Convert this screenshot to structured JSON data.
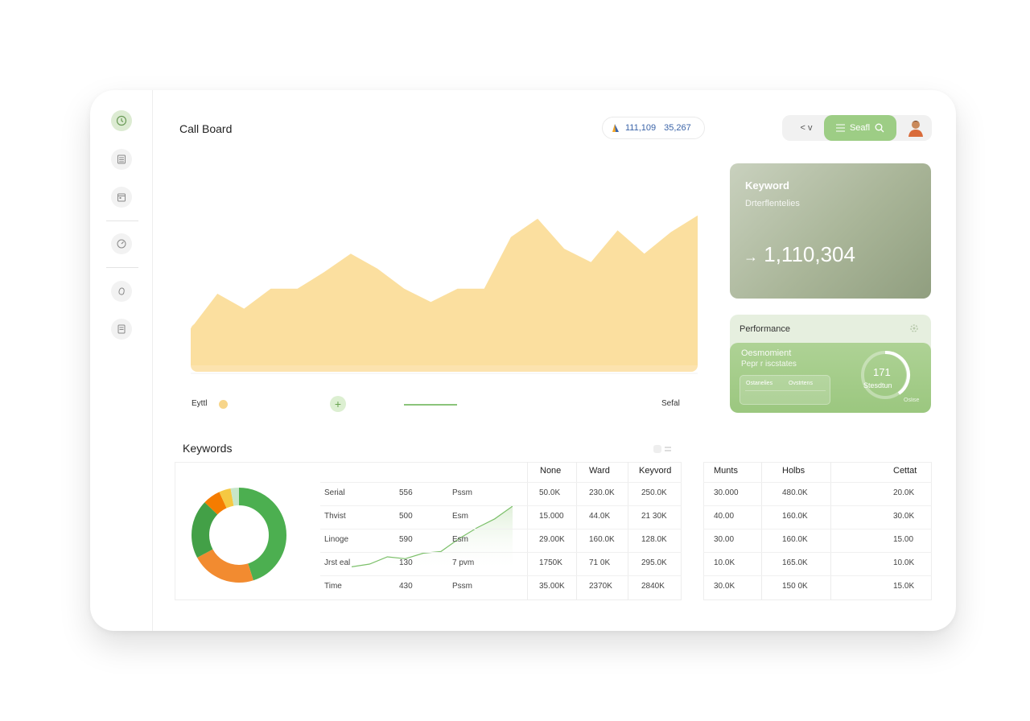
{
  "header": {
    "title": "Call Board",
    "stat_value_1": "111,109",
    "stat_value_2": "35,267",
    "lang_label": "< v",
    "search_label": "Seafl"
  },
  "sidebar": {
    "items": [
      {
        "icon": "clock-icon",
        "active": true
      },
      {
        "icon": "calculator-icon"
      },
      {
        "icon": "calendar-icon"
      },
      {
        "icon": "gauge-icon"
      },
      {
        "icon": "thumb-icon"
      },
      {
        "icon": "document-icon"
      }
    ]
  },
  "keyword_card": {
    "title": "Keyword",
    "subtitle": "Drterflentelies",
    "value": "1,110,304",
    "arrow": "→"
  },
  "performance_card": {
    "title": "Performance",
    "line1": "Oesmomient",
    "line2": "Pepr r iscstates",
    "mini_col1": "Ostanelies",
    "mini_col2": "Ovstrtens",
    "gauge_value": "171",
    "gauge_label": "Stesdtun",
    "corner_label": "Oslise"
  },
  "legend": {
    "left_label": "Eyttl",
    "add_symbol": "+",
    "right_label": "Sefal"
  },
  "area_chart": {
    "values": [
      22,
      43,
      34,
      46,
      46,
      56,
      67,
      58,
      46,
      38,
      46,
      46,
      77,
      88,
      70,
      62,
      81,
      67,
      80,
      90
    ]
  },
  "keywords": {
    "title": "Keywords",
    "donut": [
      {
        "value": 45,
        "color": "#4caf50"
      },
      {
        "value": 22,
        "color": "#f28b30"
      },
      {
        "value": 20,
        "color": "#43a047"
      },
      {
        "value": 6,
        "color": "#f57c00"
      },
      {
        "value": 4,
        "color": "#f5c842"
      },
      {
        "value": 3,
        "color": "#c8e6c9"
      }
    ],
    "sparkline": [
      5,
      8,
      16,
      14,
      20,
      22,
      36,
      48,
      58,
      72
    ],
    "columns": [
      "None",
      "Ward",
      "Keyvord"
    ],
    "rows": [
      {
        "name": "Serial",
        "num": "556",
        "term": "Pssm",
        "c1": "50.0K",
        "c2": "230.0K",
        "c3": "250.0K"
      },
      {
        "name": "Thvist",
        "num": "500",
        "term": "Esm",
        "c1": "15.000",
        "c2": "44.0K",
        "c3": "21 30K"
      },
      {
        "name": "Linoge",
        "num": "590",
        "term": "Esm",
        "c1": "29.00K",
        "c2": "160.0K",
        "c3": "128.0K"
      },
      {
        "name": "Jrst eal",
        "num": "130",
        "term": "7 pvm",
        "c1": "1750K",
        "c2": "71 0K",
        "c3": "295.0K"
      },
      {
        "name": "Time",
        "num": "430",
        "term": "Pssm",
        "c1": "35.00K",
        "c2": "2370K",
        "c3": "2840K"
      }
    ]
  },
  "secondary_table": {
    "columns": [
      "Munts",
      "Holbs",
      "Cettat"
    ],
    "rows": [
      [
        "30.000",
        "480.0K",
        "20.0K"
      ],
      [
        "40.00",
        "160.0K",
        "30.0K"
      ],
      [
        "30.00",
        "160.0K",
        "15.00"
      ],
      [
        "10.0K",
        "165.0K",
        "10.0K"
      ],
      [
        "30.0K",
        "150 0K",
        "15.0K"
      ]
    ]
  }
}
